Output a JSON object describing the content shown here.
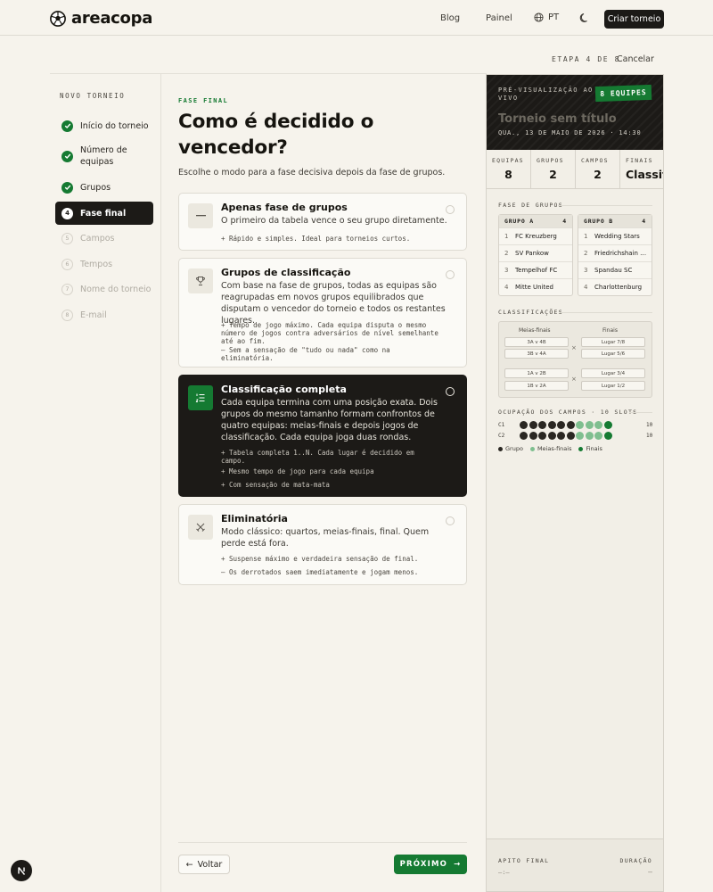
{
  "app": {
    "name": "areacopa",
    "nav": [
      {
        "label": "Blog"
      },
      {
        "label": "Painel"
      }
    ],
    "lang": "PT",
    "cta": "Criar torneio"
  },
  "wizard": {
    "step_meta": "ETAPA 4 DE 8",
    "cancel": "Cancelar",
    "title": "NOVO TORNEIO",
    "steps": [
      {
        "num": "1",
        "label": "Início do torneio",
        "state": "done"
      },
      {
        "num": "2",
        "label": "Número de equipas",
        "state": "done"
      },
      {
        "num": "3",
        "label": "Grupos",
        "state": "done"
      },
      {
        "num": "4",
        "label": "Fase final",
        "state": "active"
      },
      {
        "num": "5",
        "label": "Campos",
        "state": "pending"
      },
      {
        "num": "6",
        "label": "Tempos",
        "state": "pending"
      },
      {
        "num": "7",
        "label": "Nome do torneio",
        "state": "pending"
      },
      {
        "num": "8",
        "label": "E-mail",
        "state": "pending"
      }
    ]
  },
  "main": {
    "eyebrow": "FASE FINAL",
    "title": "Como é decidido o vencedor?",
    "subtitle": "Escolhe o modo para a fase decisiva depois da fase de grupos.",
    "options": [
      {
        "icon": "dash-icon",
        "title": "Apenas fase de grupos",
        "desc": "O primeiro da tabela vence o seu grupo diretamente.",
        "bullets": [
          "+ Rápido e simples. Ideal para torneios curtos."
        ],
        "selected": false
      },
      {
        "icon": "trophy-icon",
        "title": "Grupos de classificação",
        "desc": "Com base na fase de grupos, todas as equipas são reagrupadas em novos grupos equilibrados que disputam o vencedor do torneio e todos os restantes lugares.",
        "bullets": [
          "+ Tempo de jogo máximo. Cada equipa disputa o mesmo número de jogos contra adversários de nível semelhante até ao fim.",
          "– Sem a sensação de \"tudo ou nada\" como na eliminatória."
        ],
        "selected": false
      },
      {
        "icon": "ranked-list-icon",
        "title": "Classificação completa",
        "desc": "Cada equipa termina com uma posição exata. Dois grupos do mesmo tamanho formam confrontos de quatro equipas: meias-finais e depois jogos de classificação. Cada equipa joga duas rondas.",
        "bullets": [
          "+ Tabela completa 1..N. Cada lugar é decidido em campo.",
          "+ Mesmo tempo de jogo para cada equipa",
          "+ Com sensação de mata-mata"
        ],
        "selected": true
      },
      {
        "icon": "crossed-swords-icon",
        "title": "Eliminatória",
        "desc": "Modo clássico: quartos, meias-finais, final. Quem perde está fora.",
        "bullets": [
          "+ Suspense máximo e verdadeira sensação de final.",
          "– Os derrotados saem imediatamente e jogam menos."
        ],
        "selected": false
      }
    ],
    "back": "Voltar",
    "next": "PRÓXIMO"
  },
  "preview": {
    "label": "PRÉ-VISUALIZAÇÃO AO VIVO",
    "badge": "8 EQUIPES",
    "tournament_name": "Torneio sem título",
    "date": "QUA., 13 DE MAIO DE 2026 · 14:30",
    "stats": [
      {
        "key": "EQUIPAS",
        "value": "8"
      },
      {
        "key": "GRUPOS",
        "value": "2"
      },
      {
        "key": "CAMPOS",
        "value": "2"
      },
      {
        "key": "FINAIS",
        "value": "Classifi"
      }
    ],
    "groups_title": "FASE DE GRUPOS",
    "groups": [
      {
        "name": "GRUPO A",
        "count": "4",
        "teams": [
          "FC Kreuzberg",
          "SV Pankow",
          "Tempelhof FC",
          "Mitte United"
        ]
      },
      {
        "name": "GRUPO B",
        "count": "4",
        "teams": [
          "Wedding Stars",
          "Friedrichshain …",
          "Spandau SC",
          "Charlottenburg"
        ]
      }
    ],
    "class_title": "CLASSIFICAÇÕES",
    "bracket": {
      "semis_label": "Meias-finais",
      "finals_label": "Finais",
      "semis": [
        "3A v 4B",
        "3B v 4A",
        "1A v 2B",
        "1B v 2A"
      ],
      "finals": [
        "Lugar 7/8",
        "Lugar 5/6",
        "Lugar 3/4",
        "Lugar 1/2"
      ]
    },
    "fields_title": "OCUPAÇÃO DOS CAMPOS · 10 SLOTS",
    "fields": [
      {
        "label": "C1",
        "count": "10",
        "slots": [
          "g",
          "g",
          "g",
          "g",
          "g",
          "g",
          "s",
          "s",
          "s",
          "f"
        ]
      },
      {
        "label": "C2",
        "count": "10",
        "slots": [
          "g",
          "g",
          "g",
          "g",
          "g",
          "g",
          "s",
          "s",
          "s",
          "f"
        ]
      }
    ],
    "legend": [
      {
        "label": "Grupo",
        "color": "#2a2722"
      },
      {
        "label": "Meias-finais",
        "color": "#7fbf8f"
      },
      {
        "label": "Finais",
        "color": "#157a32"
      }
    ],
    "footer": {
      "left": "APITO FINAL",
      "right": "DURAÇÃO",
      "left_value": "—:—",
      "right_value": "—"
    }
  }
}
